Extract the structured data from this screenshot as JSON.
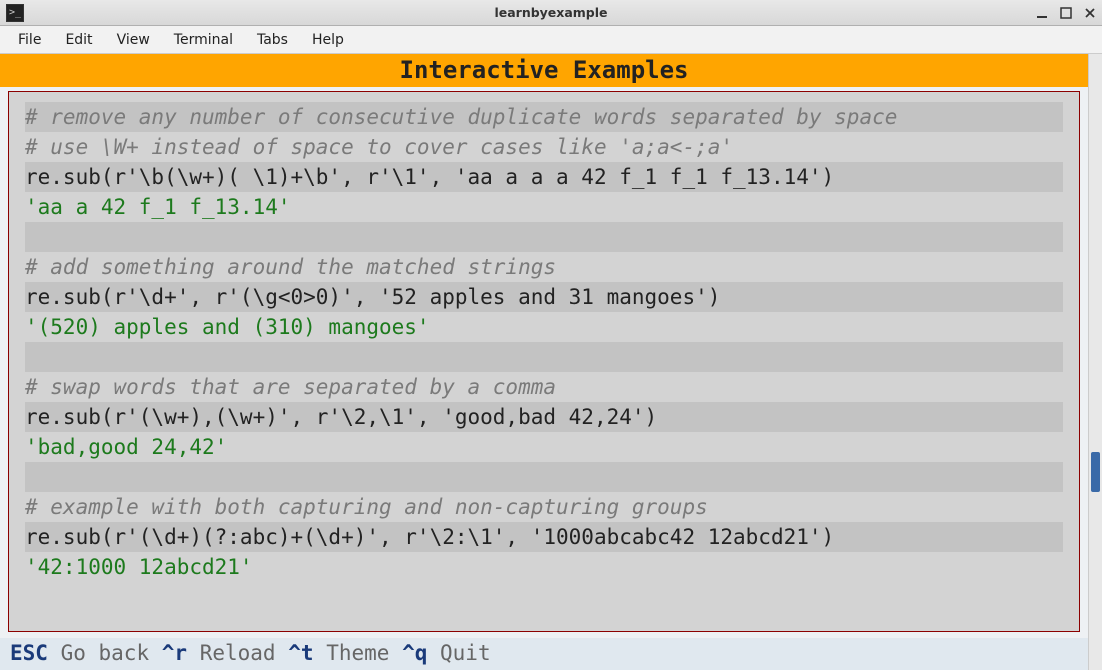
{
  "window": {
    "title": "learnbyexample",
    "icon_glyph": ">_"
  },
  "menubar": [
    "File",
    "Edit",
    "View",
    "Terminal",
    "Tabs",
    "Help"
  ],
  "header": "Interactive Examples",
  "lines": [
    {
      "type": "comment",
      "text": "# remove any number of consecutive duplicate words separated by space"
    },
    {
      "type": "comment",
      "text": "# use \\W+ instead of space to cover cases like 'a;a<-;a'"
    },
    {
      "type": "code",
      "text": "re.sub(r'\\b(\\w+)( \\1)+\\b', r'\\1', 'aa a a a 42 f_1 f_1 f_13.14')"
    },
    {
      "type": "output",
      "text": "'aa a 42 f_1 f_13.14'"
    },
    {
      "type": "blank",
      "text": " "
    },
    {
      "type": "comment",
      "text": "# add something around the matched strings"
    },
    {
      "type": "code",
      "text": "re.sub(r'\\d+', r'(\\g<0>0)', '52 apples and 31 mangoes')"
    },
    {
      "type": "output",
      "text": "'(520) apples and (310) mangoes'"
    },
    {
      "type": "blank",
      "text": " "
    },
    {
      "type": "comment",
      "text": "# swap words that are separated by a comma"
    },
    {
      "type": "code",
      "text": "re.sub(r'(\\w+),(\\w+)', r'\\2,\\1', 'good,bad 42,24')"
    },
    {
      "type": "output",
      "text": "'bad,good 24,42'"
    },
    {
      "type": "blank",
      "text": " "
    },
    {
      "type": "comment",
      "text": "# example with both capturing and non-capturing groups"
    },
    {
      "type": "code",
      "text": "re.sub(r'(\\d+)(?:abc)+(\\d+)', r'\\2:\\1', '1000abcabc42 12abcd21')"
    },
    {
      "type": "output",
      "text": "'42:1000 12abcd21'"
    }
  ],
  "footer": [
    {
      "key": "ESC",
      "label": "Go back"
    },
    {
      "key": "^r",
      "label": "Reload"
    },
    {
      "key": "^t",
      "label": "Theme"
    },
    {
      "key": "^q",
      "label": "Quit"
    }
  ]
}
